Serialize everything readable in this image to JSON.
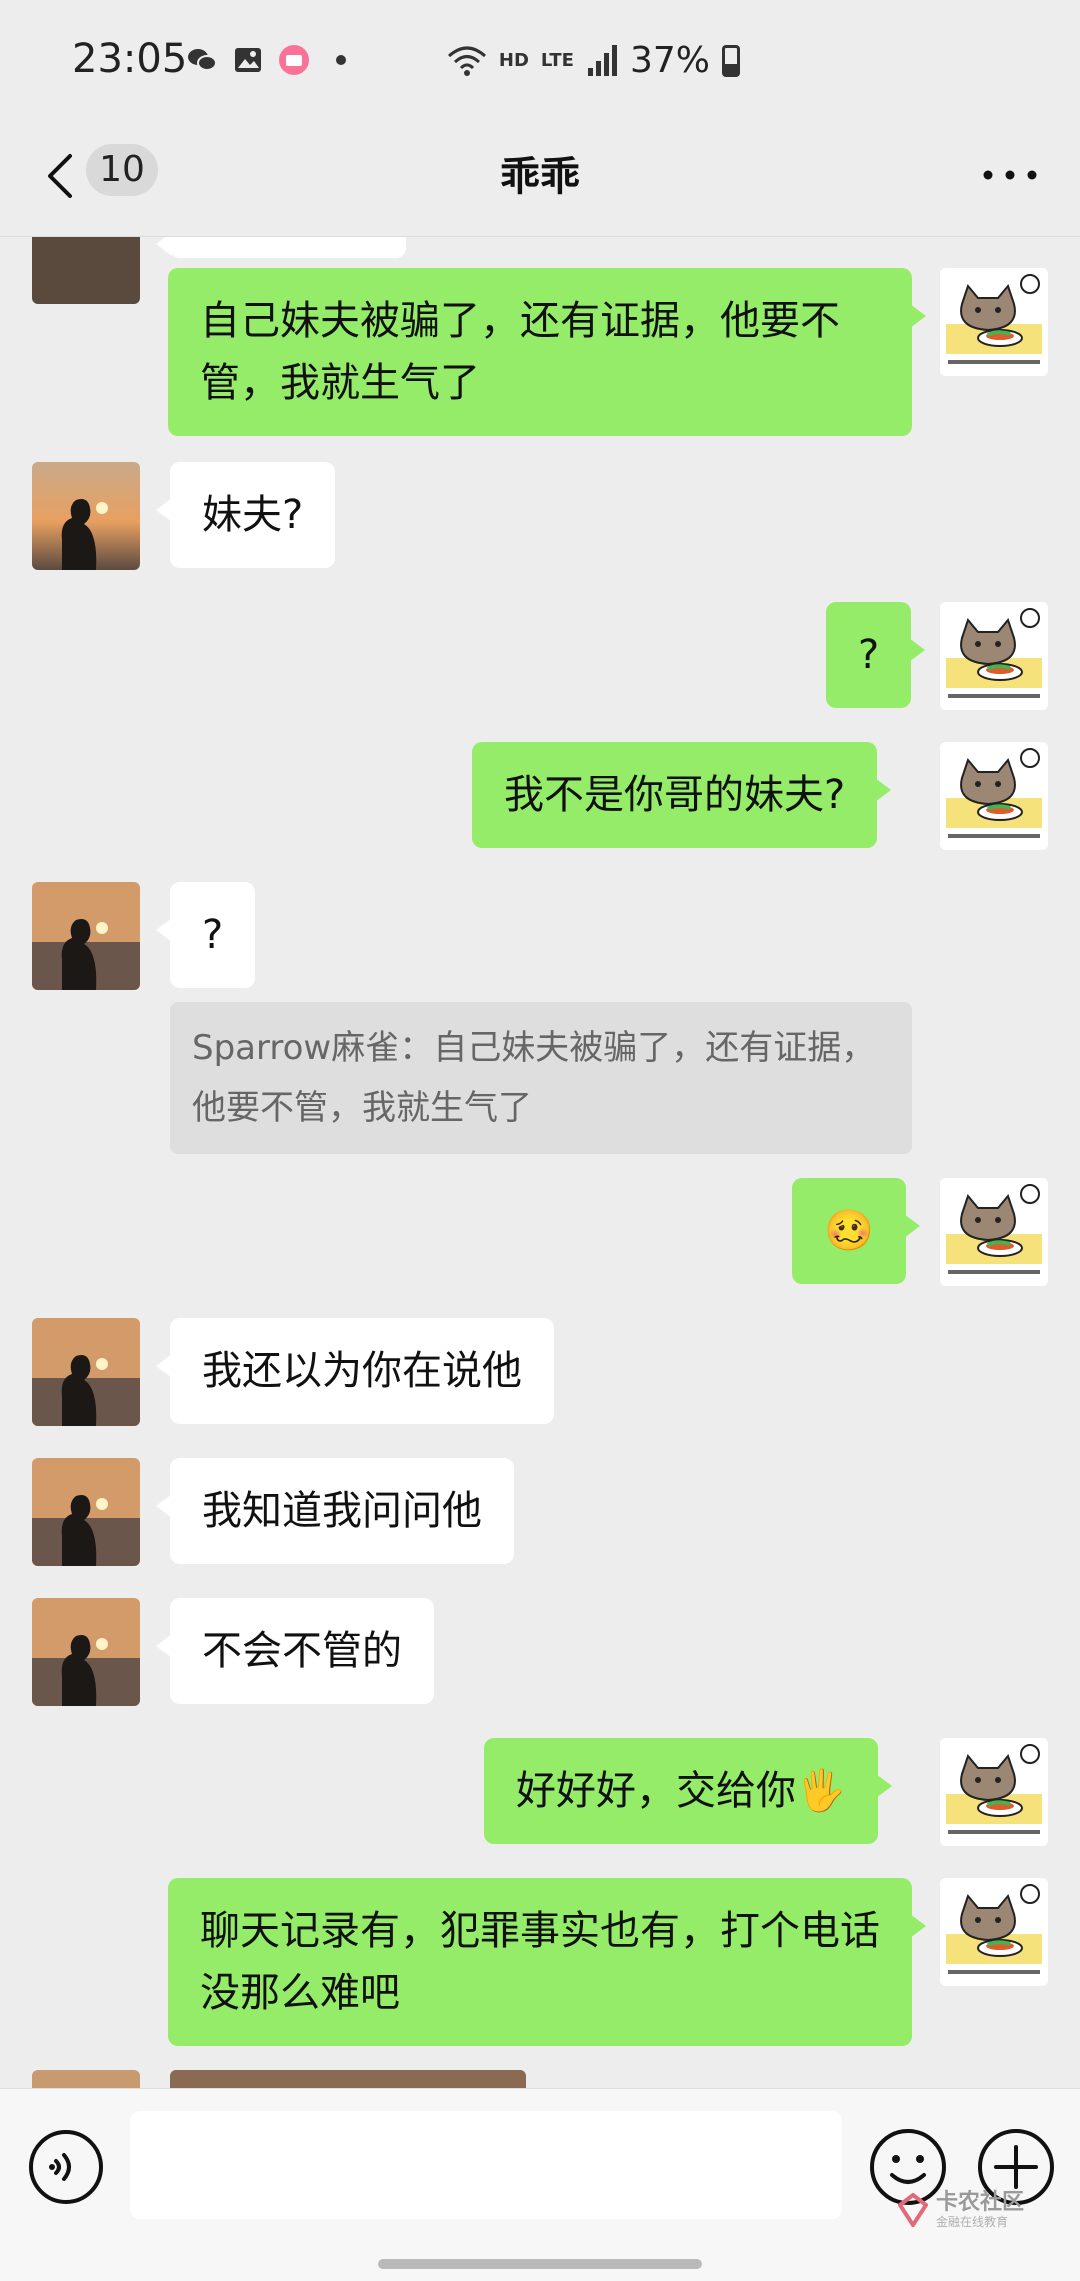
{
  "status_bar": {
    "time": "23:05",
    "network_small": "HD",
    "network_type": "LTE",
    "battery": "37%",
    "icons": [
      "wechat-icon",
      "gallery-icon",
      "bilibili-icon",
      "wifi-icon",
      "signal-icon",
      "battery-icon"
    ]
  },
  "header": {
    "unread_count": "10",
    "title": "乖乖",
    "icons": [
      "back-icon",
      "more-icon"
    ]
  },
  "messages": [
    {
      "side": "me",
      "text": "自己妹夫被骗了，还有证据，他要不管，我就生气了"
    },
    {
      "side": "them",
      "text": "妹夫?"
    },
    {
      "side": "me",
      "text": "?"
    },
    {
      "side": "me",
      "text": "我不是你哥的妹夫?"
    },
    {
      "side": "them",
      "text": "?"
    },
    {
      "side": "quote",
      "text": "Sparrow麻雀：自己妹夫被骗了，还有证据，他要不管，我就生气了"
    },
    {
      "side": "me",
      "text": "🥴"
    },
    {
      "side": "them",
      "text": "我还以为你在说他"
    },
    {
      "side": "them",
      "text": "我知道我问问他"
    },
    {
      "side": "them",
      "text": "不会不管的"
    },
    {
      "side": "me",
      "text": "好好好，交给你🖐"
    },
    {
      "side": "me",
      "text": "聊天记录有，犯罪事实也有，打个电话没那么难吧"
    }
  ],
  "input_bar": {
    "placeholder": "",
    "icons": [
      "voice-icon",
      "emoji-icon",
      "plus-icon"
    ]
  },
  "watermark": {
    "title": "卡农社区",
    "subtitle": "金融在线教育"
  },
  "colors": {
    "background": "#ededed",
    "my_bubble": "#95ec69",
    "their_bubble": "#ffffff"
  }
}
